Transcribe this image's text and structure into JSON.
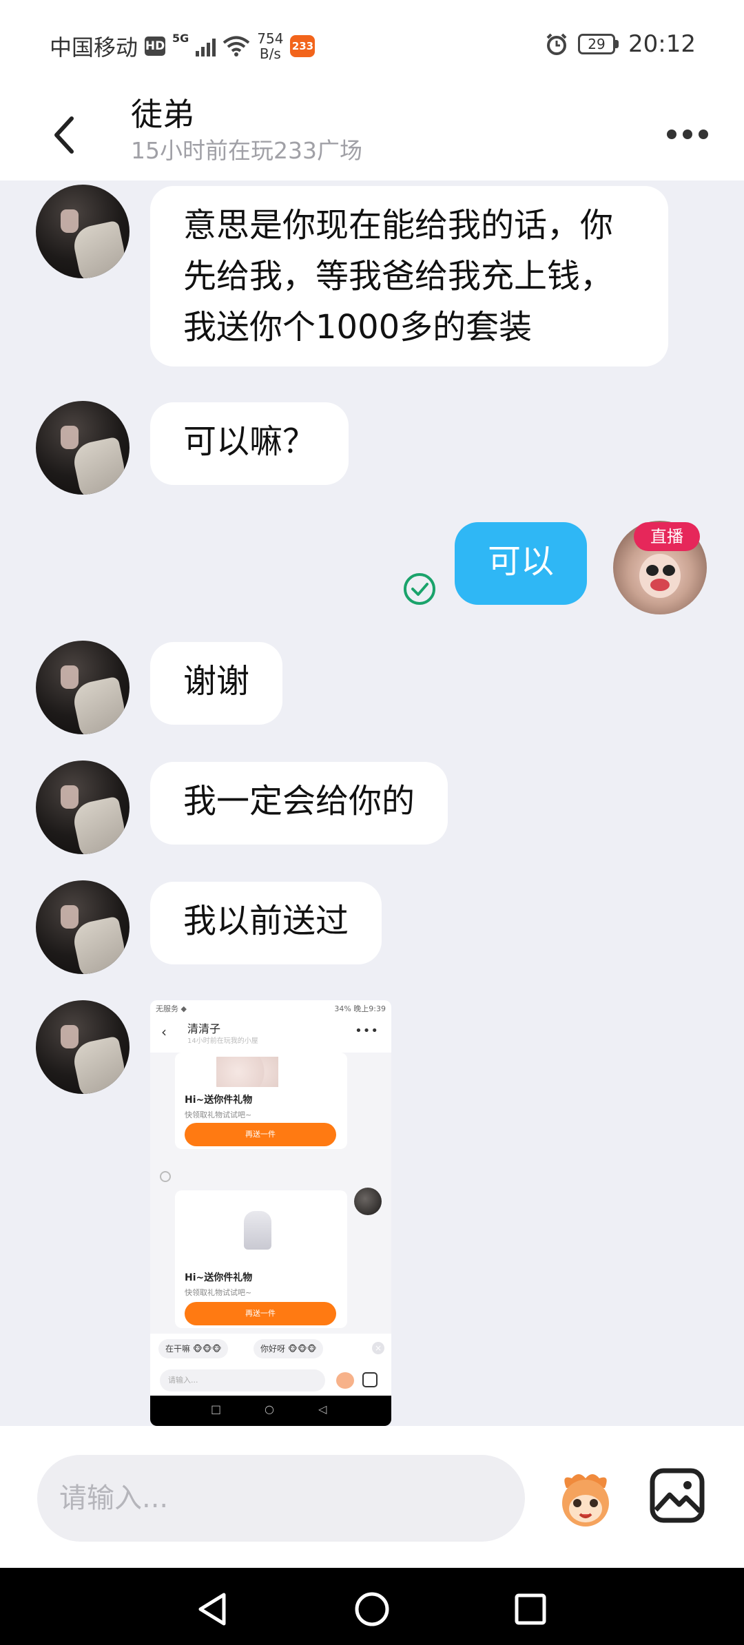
{
  "status_bar": {
    "carrier": "中国移动",
    "hd": "HD",
    "network": "5G",
    "speed_value": "754",
    "speed_unit": "B/s",
    "app_badge": "233",
    "battery": "29",
    "time": "20:12"
  },
  "header": {
    "title": "徒弟",
    "subtitle": "15小时前在玩233广场"
  },
  "messages": {
    "m1": "意思是你现在能给我的话，你先给我，等我爸给我充上钱，我送你个1000多的套装",
    "m2": "可以嘛？",
    "m3": "可以",
    "m4": "谢谢",
    "m5": "我一定会给你的",
    "m6": "我以前送过",
    "live_tag": "直播"
  },
  "shared_image": {
    "status_left": "无服务 ◆",
    "status_right": "34% 晚上9:39",
    "title": "清清子",
    "subtitle": "14小时前在玩我的小屋",
    "card1_title": "Hi~送你件礼物",
    "card1_desc": "快领取礼物试试吧~",
    "card1_button": "再送一件",
    "card2_title": "Hi~送你件礼物",
    "card2_desc": "快领取礼物试试吧~",
    "card2_button": "再送一件",
    "chip1": "在干嘛 🐵🐵🐵",
    "chip2": "你好呀 🐵🐵🐵",
    "input_placeholder": "请输入..."
  },
  "input_bar": {
    "placeholder": "请输入..."
  },
  "colors": {
    "sent_bubble": "#2fb7f5",
    "background": "#eeeff5",
    "orange_button": "#ff7a12",
    "sent_check": "#1aa36b"
  },
  "icons": [
    "back-arrow-icon",
    "more-icon",
    "sent-check-icon",
    "emoji-mascot-icon",
    "image-icon",
    "nav-back-icon",
    "nav-home-icon",
    "nav-recent-icon"
  ]
}
